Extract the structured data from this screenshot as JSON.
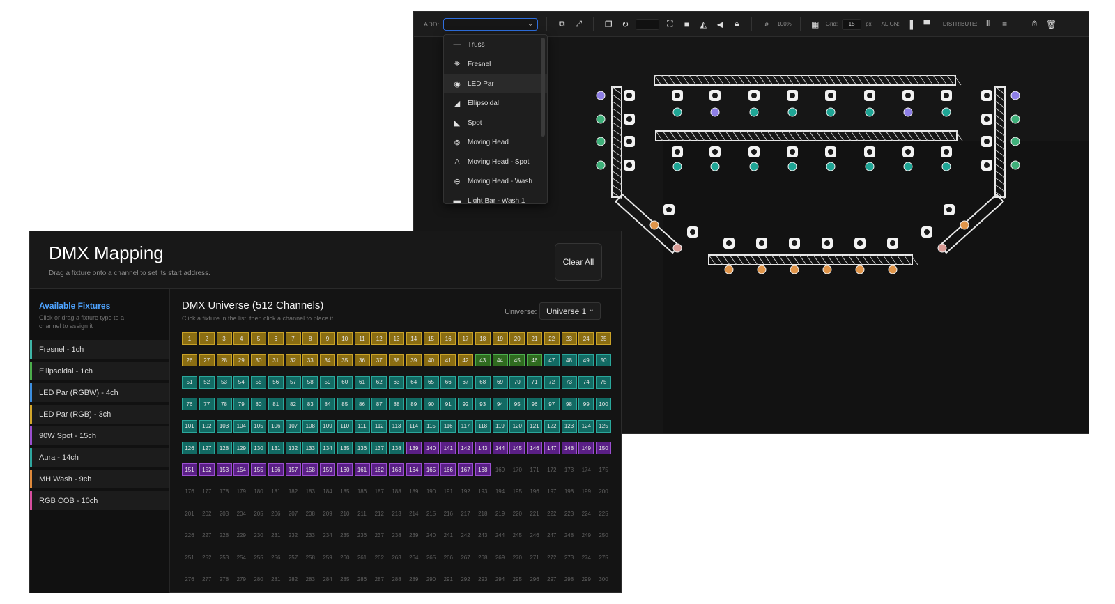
{
  "plot_window": {
    "toolbar": {
      "add_label": "ADD:",
      "zoom": "100%",
      "grid_label": "Grid:",
      "grid_value": "15",
      "grid_unit": "px",
      "align_label": "ALIGN:",
      "distribute_label": "DISTRIBUTE:",
      "icons": [
        "duplicate-icon",
        "resize-icon",
        "copy-icon",
        "rotate-icon",
        "fit-icon",
        "layer-icon",
        "flip-h-icon",
        "flip-v-icon",
        "lock-icon",
        "zoom-icon",
        "grid-icon",
        "align-left-icon",
        "align-top-icon",
        "distribute-h-icon",
        "distribute-v-icon",
        "pan-icon",
        "trash-icon"
      ]
    },
    "add_dropdown": {
      "items": [
        {
          "label": "Truss",
          "icon": "truss-icon"
        },
        {
          "label": "Fresnel",
          "icon": "fresnel-icon"
        },
        {
          "label": "LED Par",
          "icon": "led-par-icon",
          "selected": true
        },
        {
          "label": "Ellipsoidal",
          "icon": "ellipsoidal-icon"
        },
        {
          "label": "Spot",
          "icon": "spot-icon"
        },
        {
          "label": "Moving Head",
          "icon": "moving-head-icon"
        },
        {
          "label": "Moving Head - Spot",
          "icon": "moving-head-spot-icon"
        },
        {
          "label": "Moving Head - Wash",
          "icon": "moving-head-wash-icon"
        },
        {
          "label": "Light Bar - Wash 1",
          "icon": "light-bar-icon"
        }
      ]
    },
    "marker_colors": {
      "teal": "#1fa595",
      "purple": "#8e7fe6",
      "green": "#3fb07a",
      "orange": "#e0954a",
      "pink": "#d99a94"
    }
  },
  "dmx": {
    "title": "DMX Mapping",
    "subtitle": "Drag a fixture onto a channel to set its start address.",
    "clear_all": "Clear All",
    "panel": {
      "title": "Available Fixtures",
      "hint": "Click or drag a fixture type to a channel to assign it"
    },
    "fixtures": [
      {
        "label": "Fresnel  -  1ch",
        "color": "#3fb6a8"
      },
      {
        "label": "Ellipsoidal  -  1ch",
        "color": "#4cae4c"
      },
      {
        "label": "LED Par (RGBW)  -  4ch",
        "color": "#3d8fe0"
      },
      {
        "label": "LED Par (RGB)  -  3ch",
        "color": "#d4a72c"
      },
      {
        "label": "90W Spot  -  15ch",
        "color": "#9b4fd0"
      },
      {
        "label": "Aura  -  14ch",
        "color": "#2fa7a0"
      },
      {
        "label": "MH Wash  -  9ch",
        "color": "#e08a3c"
      },
      {
        "label": "RGB COB  -  10ch",
        "color": "#d94fa0"
      }
    ],
    "universe_title": "DMX Universe (512 Channels)",
    "universe_hint": "Click a fixture in the list, then click a channel to place it",
    "universe_label": "Universe:",
    "universe_value": "Universe 1",
    "channel_first": 1,
    "channel_last": 300,
    "channel_ranges": [
      {
        "from": 1,
        "to": 42,
        "color": "#8a6d12",
        "border": "#c9a227"
      },
      {
        "from": 43,
        "to": 46,
        "color": "#2f6b1f",
        "border": "#4cae4c"
      },
      {
        "from": 47,
        "to": 138,
        "color": "#126a63",
        "border": "#2aa79b"
      },
      {
        "from": 139,
        "to": 168,
        "color": "#5a1f86",
        "border": "#9b4fd0"
      }
    ]
  }
}
